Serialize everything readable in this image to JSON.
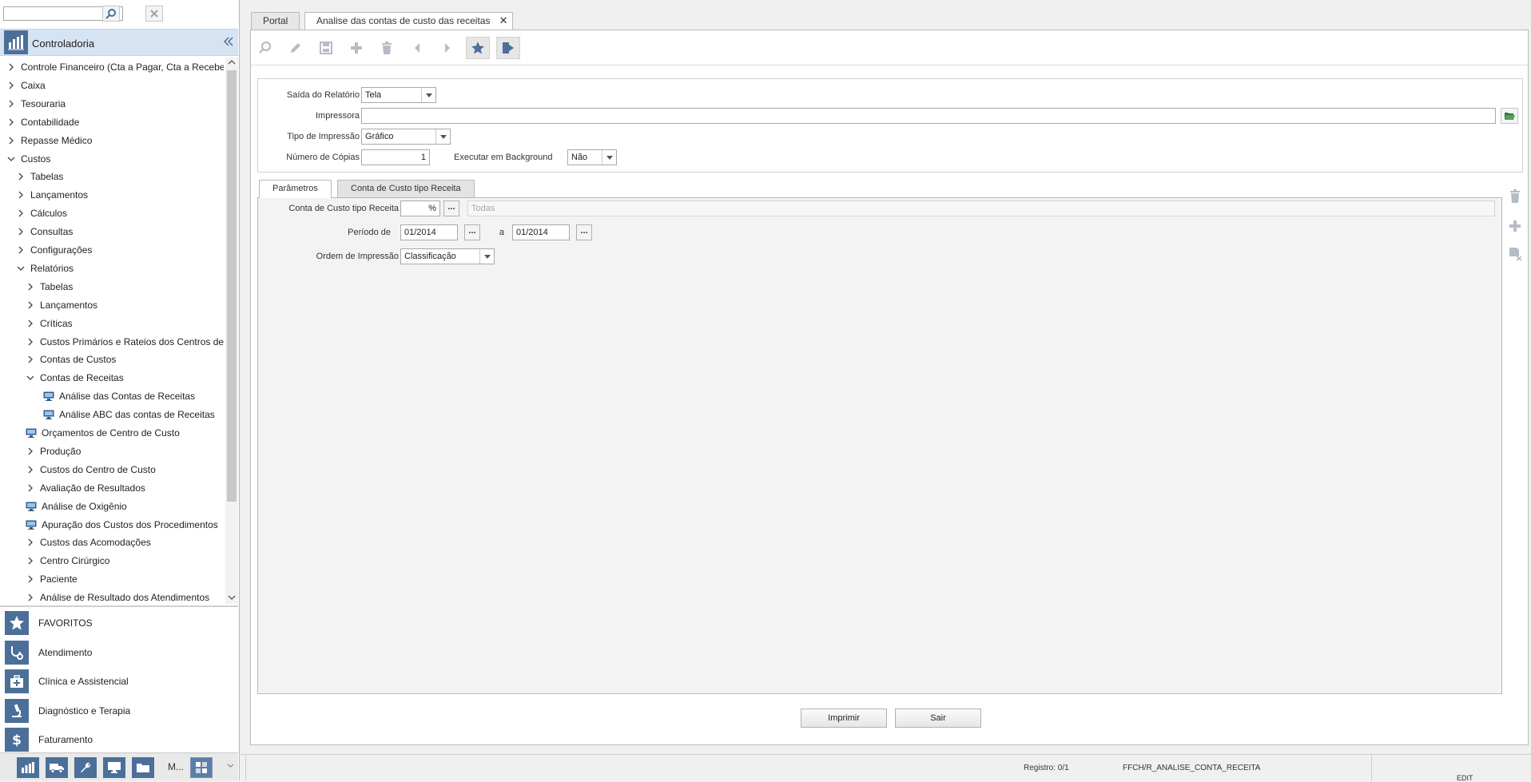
{
  "search": {
    "value": "",
    "placeholder": ""
  },
  "module": {
    "title": "Controladoria"
  },
  "tree": [
    {
      "label": "Controle Financeiro (Cta a Pagar, Cta a Receber, Banc",
      "level": 0,
      "state": "collapsed"
    },
    {
      "label": "Caixa",
      "level": 0,
      "state": "collapsed"
    },
    {
      "label": "Tesouraria",
      "level": 0,
      "state": "collapsed"
    },
    {
      "label": "Contabilidade",
      "level": 0,
      "state": "collapsed"
    },
    {
      "label": "Repasse Médico",
      "level": 0,
      "state": "collapsed"
    },
    {
      "label": "Custos",
      "level": 0,
      "state": "expanded"
    },
    {
      "label": "Tabelas",
      "level": 1,
      "state": "collapsed"
    },
    {
      "label": "Lançamentos",
      "level": 1,
      "state": "collapsed"
    },
    {
      "label": "Cálculos",
      "level": 1,
      "state": "collapsed"
    },
    {
      "label": "Consultas",
      "level": 1,
      "state": "collapsed"
    },
    {
      "label": "Configurações",
      "level": 1,
      "state": "collapsed"
    },
    {
      "label": "Relatórios",
      "level": 1,
      "state": "expanded"
    },
    {
      "label": "Tabelas",
      "level": 2,
      "state": "collapsed"
    },
    {
      "label": "Lançamentos",
      "level": 2,
      "state": "collapsed"
    },
    {
      "label": "Críticas",
      "level": 2,
      "state": "collapsed"
    },
    {
      "label": "Custos Primários e Rateios dos Centros de Custo",
      "level": 2,
      "state": "collapsed"
    },
    {
      "label": "Contas de Custos",
      "level": 2,
      "state": "collapsed"
    },
    {
      "label": "Contas de Receitas",
      "level": 2,
      "state": "expanded"
    },
    {
      "label": "Análise das Contas de Receitas",
      "level": 3,
      "state": "leaf"
    },
    {
      "label": "Análise ABC das contas de Receitas",
      "level": 3,
      "state": "leaf"
    },
    {
      "label": "Orçamentos de Centro de Custo",
      "level": 2,
      "state": "leaf"
    },
    {
      "label": "Produção",
      "level": 2,
      "state": "collapsed"
    },
    {
      "label": "Custos do Centro de Custo",
      "level": 2,
      "state": "collapsed"
    },
    {
      "label": "Avaliação de Resultados",
      "level": 2,
      "state": "collapsed"
    },
    {
      "label": "Análise de Oxigênio",
      "level": 2,
      "state": "leaf"
    },
    {
      "label": "Apuração dos Custos dos Procedimentos",
      "level": 2,
      "state": "leaf"
    },
    {
      "label": "Custos das Acomodações",
      "level": 2,
      "state": "collapsed"
    },
    {
      "label": "Centro Cirúrgico",
      "level": 2,
      "state": "collapsed"
    },
    {
      "label": "Paciente",
      "level": 2,
      "state": "collapsed"
    },
    {
      "label": "Análise de Resultado dos Atendimentos",
      "level": 2,
      "state": "collapsed"
    }
  ],
  "nav_sections": [
    {
      "label": "FAVORITOS",
      "icon": "star-icon"
    },
    {
      "label": "Atendimento",
      "icon": "stethoscope-icon"
    },
    {
      "label": "Clínica e Assistencial",
      "icon": "medkit-icon"
    },
    {
      "label": "Diagnóstico e Terapia",
      "icon": "microscope-icon"
    },
    {
      "label": "Faturamento",
      "icon": "dollar-icon"
    }
  ],
  "bottom_bar": {
    "more_label": "M..."
  },
  "tabs": {
    "portal": "Portal",
    "active": "Analise das contas de custo das receitas",
    "close": "✕"
  },
  "form": {
    "saida_label": "Saída do Relatório",
    "saida_value": "Tela",
    "impressora_label": "Impressora",
    "impressora_value": "",
    "tipo_label": "Tipo de Impressão",
    "tipo_value": "Gráfico",
    "copias_label": "Número de Cópias",
    "copias_value": "1",
    "background_label": "Executar em Background",
    "background_value": "Não"
  },
  "param_tabs": {
    "params": "Parâmetros",
    "conta": "Conta de Custo tipo Receita"
  },
  "params": {
    "conta_label": "Conta de Custo tipo Receita",
    "conta_value": "%",
    "conta_desc": "Todas",
    "periodo_label": "Período de",
    "periodo_de": "01/2014",
    "periodo_a_label": "a",
    "periodo_ate": "01/2014",
    "ordem_label": "Ordem de Impressão",
    "ordem_value": "Classificação",
    "ellipsis": "..."
  },
  "buttons": {
    "imprimir": "Imprimir",
    "sair": "Sair"
  },
  "status": {
    "registro": "Registro: 0/1",
    "program": "FFCH/R_ANALISE_CONTA_RECEITA",
    "mode": "EDIT"
  },
  "colors": {
    "module_blue": "#4c6f99",
    "highlight": "#d6e3f3",
    "icon_gray": "#b5bcc6"
  }
}
